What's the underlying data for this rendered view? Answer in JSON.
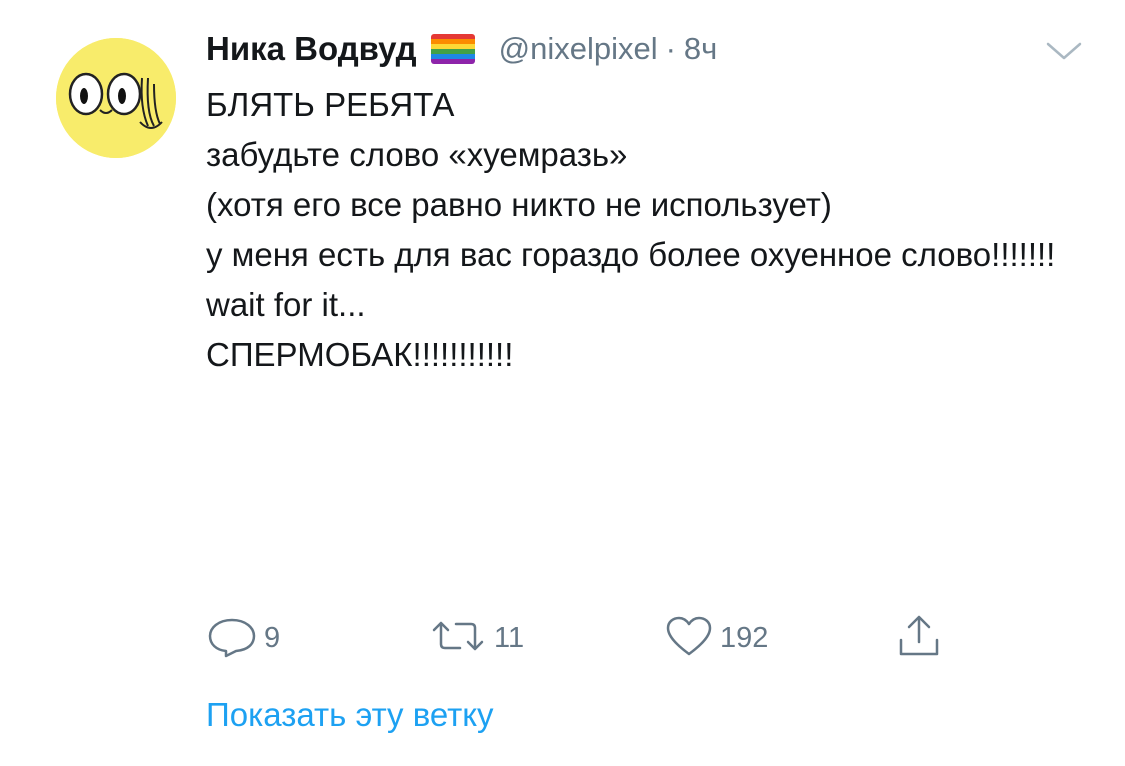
{
  "tweet": {
    "author": {
      "name": "Ника Водвуд",
      "handle": "@nixelpixel",
      "separator": "·",
      "time": "8ч",
      "avatar_icon": "cartoon-face-avatar",
      "flag_icon": "rainbow-flag-emoji"
    },
    "menu_icon": "chevron-down-icon",
    "paragraphs": [
      "БЛЯТЬ РЕБЯТА",
      "",
      "забудьте слово «хуемразь»",
      "(хотя его все равно никто не использует)",
      "",
      "у меня есть для вас гораздо более охуенное слово!!!!!!!",
      "",
      "wait for it...",
      "СПЕРМОБАК!!!!!!!!!!!"
    ],
    "actions": {
      "reply": {
        "icon": "reply-bubble-icon",
        "count": "9"
      },
      "retweet": {
        "icon": "retweet-icon",
        "count": "11"
      },
      "like": {
        "icon": "heart-icon",
        "count": "192"
      },
      "share": {
        "icon": "share-upload-icon"
      }
    },
    "show_thread_label": "Показать эту ветку",
    "colors": {
      "text": "#14171a",
      "secondary": "#657786",
      "link": "#1da1f2",
      "avatar_bg": "#f8ec6b"
    }
  }
}
